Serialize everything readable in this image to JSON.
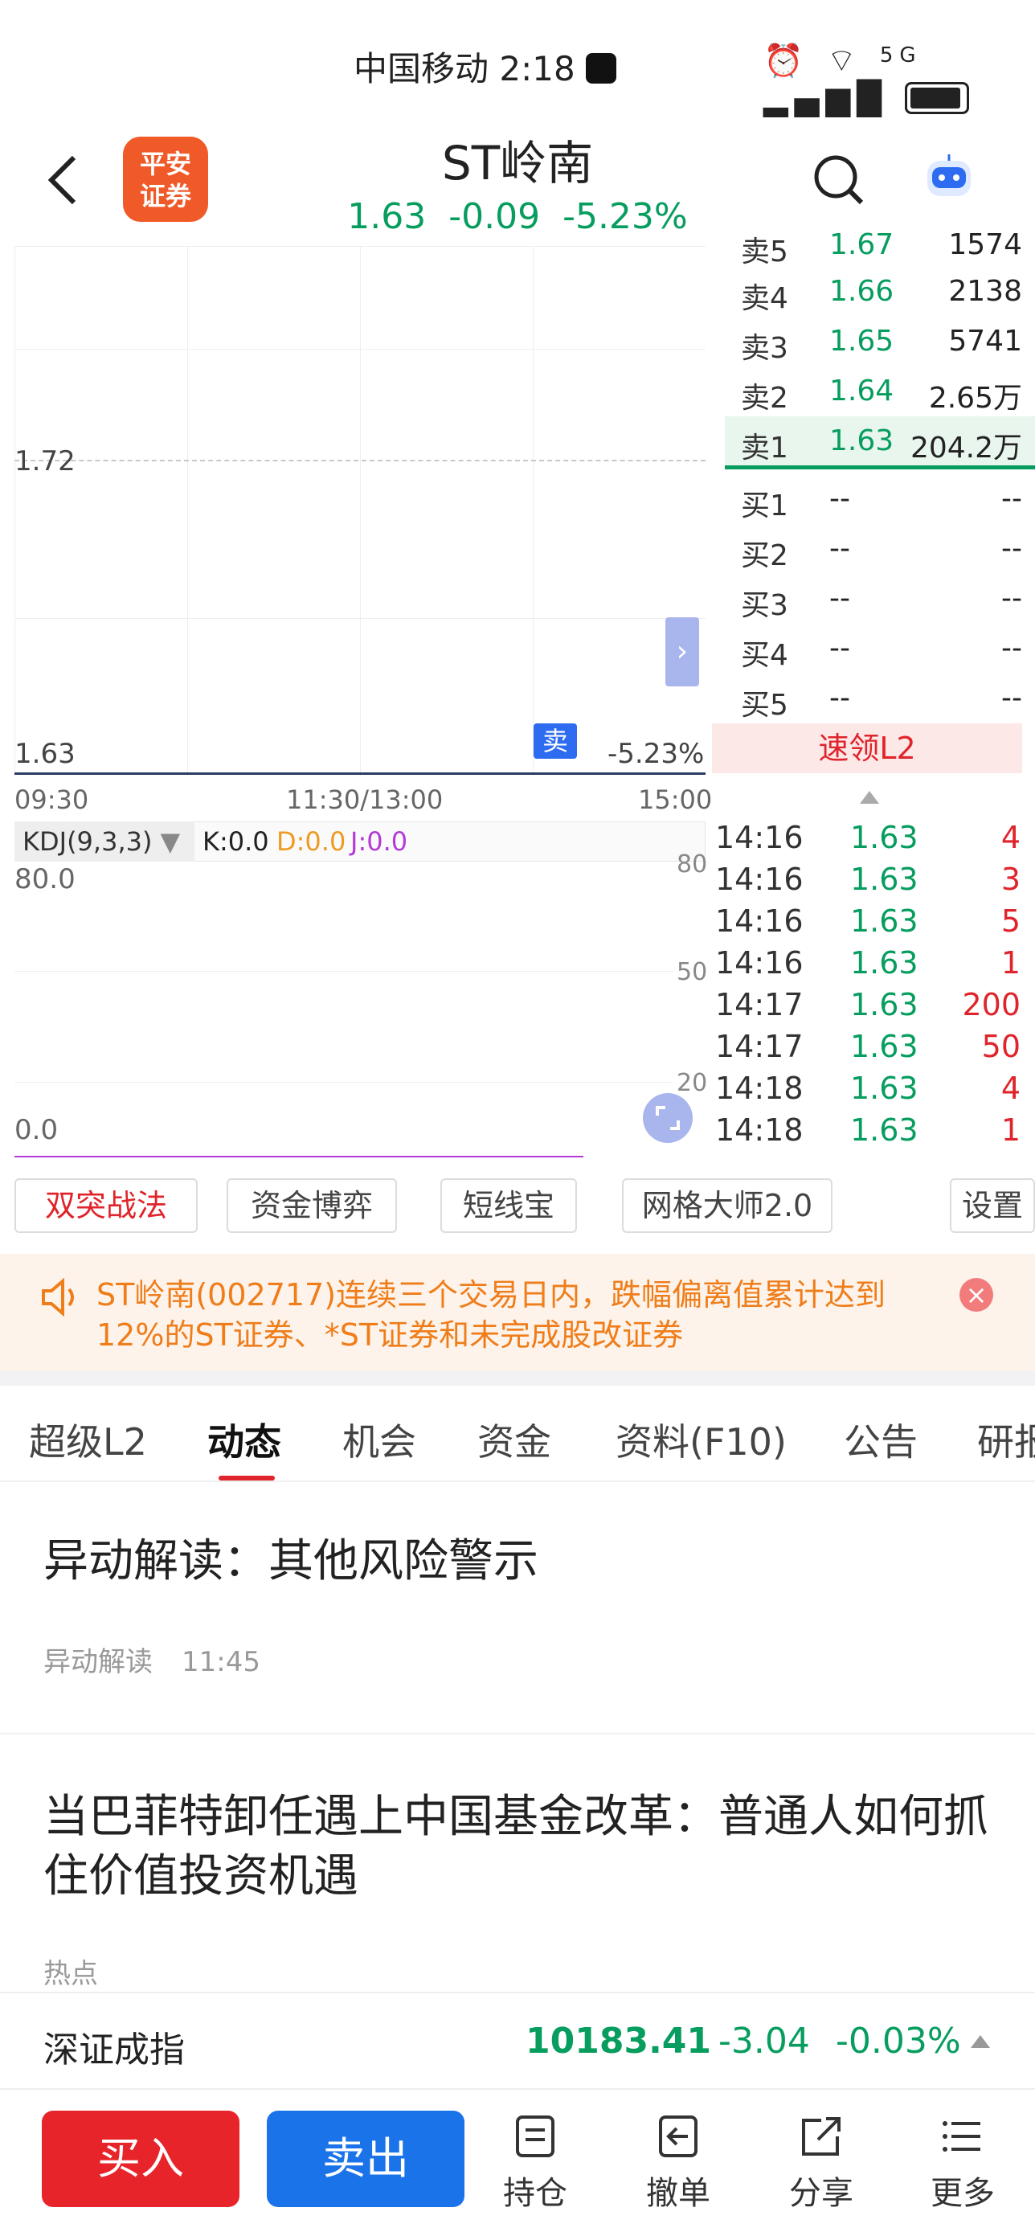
{
  "status_bar": {
    "carrier": "中国移动",
    "time": "2:18",
    "network": "5G"
  },
  "header": {
    "logo_line1": "平安",
    "logo_line2": "证券",
    "title": "ST岭南",
    "price": "1.63",
    "change": "-0.09",
    "change_pct": "-5.23%"
  },
  "chart": {
    "price_high": "1.72",
    "price_current": "1.63",
    "pct_right": "-5.23%",
    "sell_marker": "卖",
    "time_labels": [
      "09:30",
      "11:30/13:00",
      "15:00"
    ],
    "kdj_select": "KDJ(9,3,3)",
    "k": "K:0.0",
    "d": "D:0.0",
    "j": "J:0.0",
    "kdj_top": "80.0",
    "kdj_bottom": "0.0",
    "kdj_right": [
      "80",
      "50",
      "20"
    ]
  },
  "order_book": {
    "sell": [
      {
        "label": "卖5",
        "price": "1.67",
        "vol": "1574"
      },
      {
        "label": "卖4",
        "price": "1.66",
        "vol": "2138"
      },
      {
        "label": "卖3",
        "price": "1.65",
        "vol": "5741"
      },
      {
        "label": "卖2",
        "price": "1.64",
        "vol": "2.65万"
      },
      {
        "label": "卖1",
        "price": "1.63",
        "vol": "204.2万"
      }
    ],
    "buy": [
      {
        "label": "买1",
        "price": "--",
        "vol": "--"
      },
      {
        "label": "买2",
        "price": "--",
        "vol": "--"
      },
      {
        "label": "买3",
        "price": "--",
        "vol": "--"
      },
      {
        "label": "买4",
        "price": "--",
        "vol": "--"
      },
      {
        "label": "买5",
        "price": "--",
        "vol": "--"
      }
    ],
    "l2_label": "速领L2"
  },
  "trades": [
    {
      "time": "14:16",
      "price": "1.63",
      "vol": "4"
    },
    {
      "time": "14:16",
      "price": "1.63",
      "vol": "3"
    },
    {
      "time": "14:16",
      "price": "1.63",
      "vol": "5"
    },
    {
      "time": "14:16",
      "price": "1.63",
      "vol": "1"
    },
    {
      "time": "14:17",
      "price": "1.63",
      "vol": "200"
    },
    {
      "time": "14:17",
      "price": "1.63",
      "vol": "50"
    },
    {
      "time": "14:18",
      "price": "1.63",
      "vol": "4"
    },
    {
      "time": "14:18",
      "price": "1.63",
      "vol": "1"
    }
  ],
  "tools": [
    "双突战法",
    "资金博弈",
    "短线宝",
    "网格大师2.0",
    "设置"
  ],
  "alert": {
    "text": "ST岭南(002717)连续三个交易日内，跌幅偏离值累计达到12%的ST证券、*ST证券和未完成股改证券"
  },
  "tabs": [
    "超级L2",
    "动态",
    "机会",
    "资金",
    "资料(F10)",
    "公告",
    "研报"
  ],
  "active_tab": "动态",
  "news": [
    {
      "title": "异动解读：其他风险警示",
      "source": "异动解读",
      "time": "11:45"
    },
    {
      "title": "当巴菲特卸任遇上中国基金改革：普通人如何抓住价值投资机遇",
      "source": "热点",
      "time": ""
    }
  ],
  "index": {
    "name": "深证成指",
    "value": "10183.41",
    "change": "-3.04",
    "pct": "-0.03%"
  },
  "bottom": {
    "buy": "买入",
    "sell": "卖出",
    "hold": "持仓",
    "cancel": "撤单",
    "share": "分享",
    "more": "更多"
  },
  "colors": {
    "green": "#079d5f",
    "red": "#e0242b",
    "sell_blue": "#1a73e8",
    "buy_red": "#e8242b",
    "alert_orange": "#ef7d1a"
  }
}
